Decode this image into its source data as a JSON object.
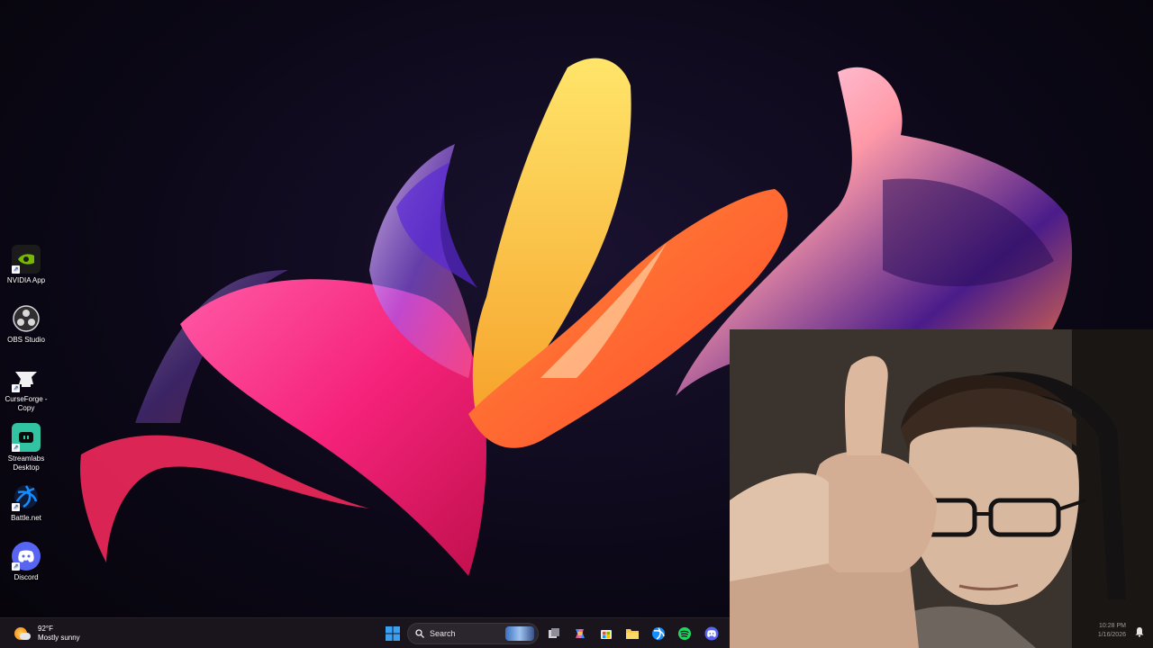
{
  "desktop": {
    "icons": [
      {
        "label": "NVIDIA App",
        "icon": "nvidia-icon"
      },
      {
        "label": "OBS Studio",
        "icon": "obs-icon"
      },
      {
        "label": "CurseForge -",
        "label2": "Copy",
        "icon": "curseforge-icon"
      },
      {
        "label": "Streamlabs",
        "label2": "Desktop",
        "icon": "streamlabs-icon"
      },
      {
        "label": "Battle.net",
        "icon": "battlenet-icon"
      },
      {
        "label": "Discord",
        "icon": "discord-icon"
      }
    ]
  },
  "taskbar": {
    "weather": {
      "temp": "92°F",
      "condition": "Mostly sunny",
      "icon": "partly-sunny-icon"
    },
    "search_placeholder": "Search",
    "pinned": [
      "start-icon",
      "task-view-icon",
      "copilot-icon",
      "store-icon",
      "file-explorer-icon",
      "battlenet-icon",
      "spotify-icon",
      "discord-icon"
    ],
    "clock": {
      "time": "10:28 PM",
      "date": "1/16/2026"
    }
  },
  "colors": {
    "taskbar_bg": "#1c161e",
    "nvidia_green": "#76b900",
    "streamlabs_teal": "#31c3a2",
    "discord_blurple": "#5865f2",
    "battlenet_blue": "#148eff",
    "spotify_green": "#1ed760"
  }
}
